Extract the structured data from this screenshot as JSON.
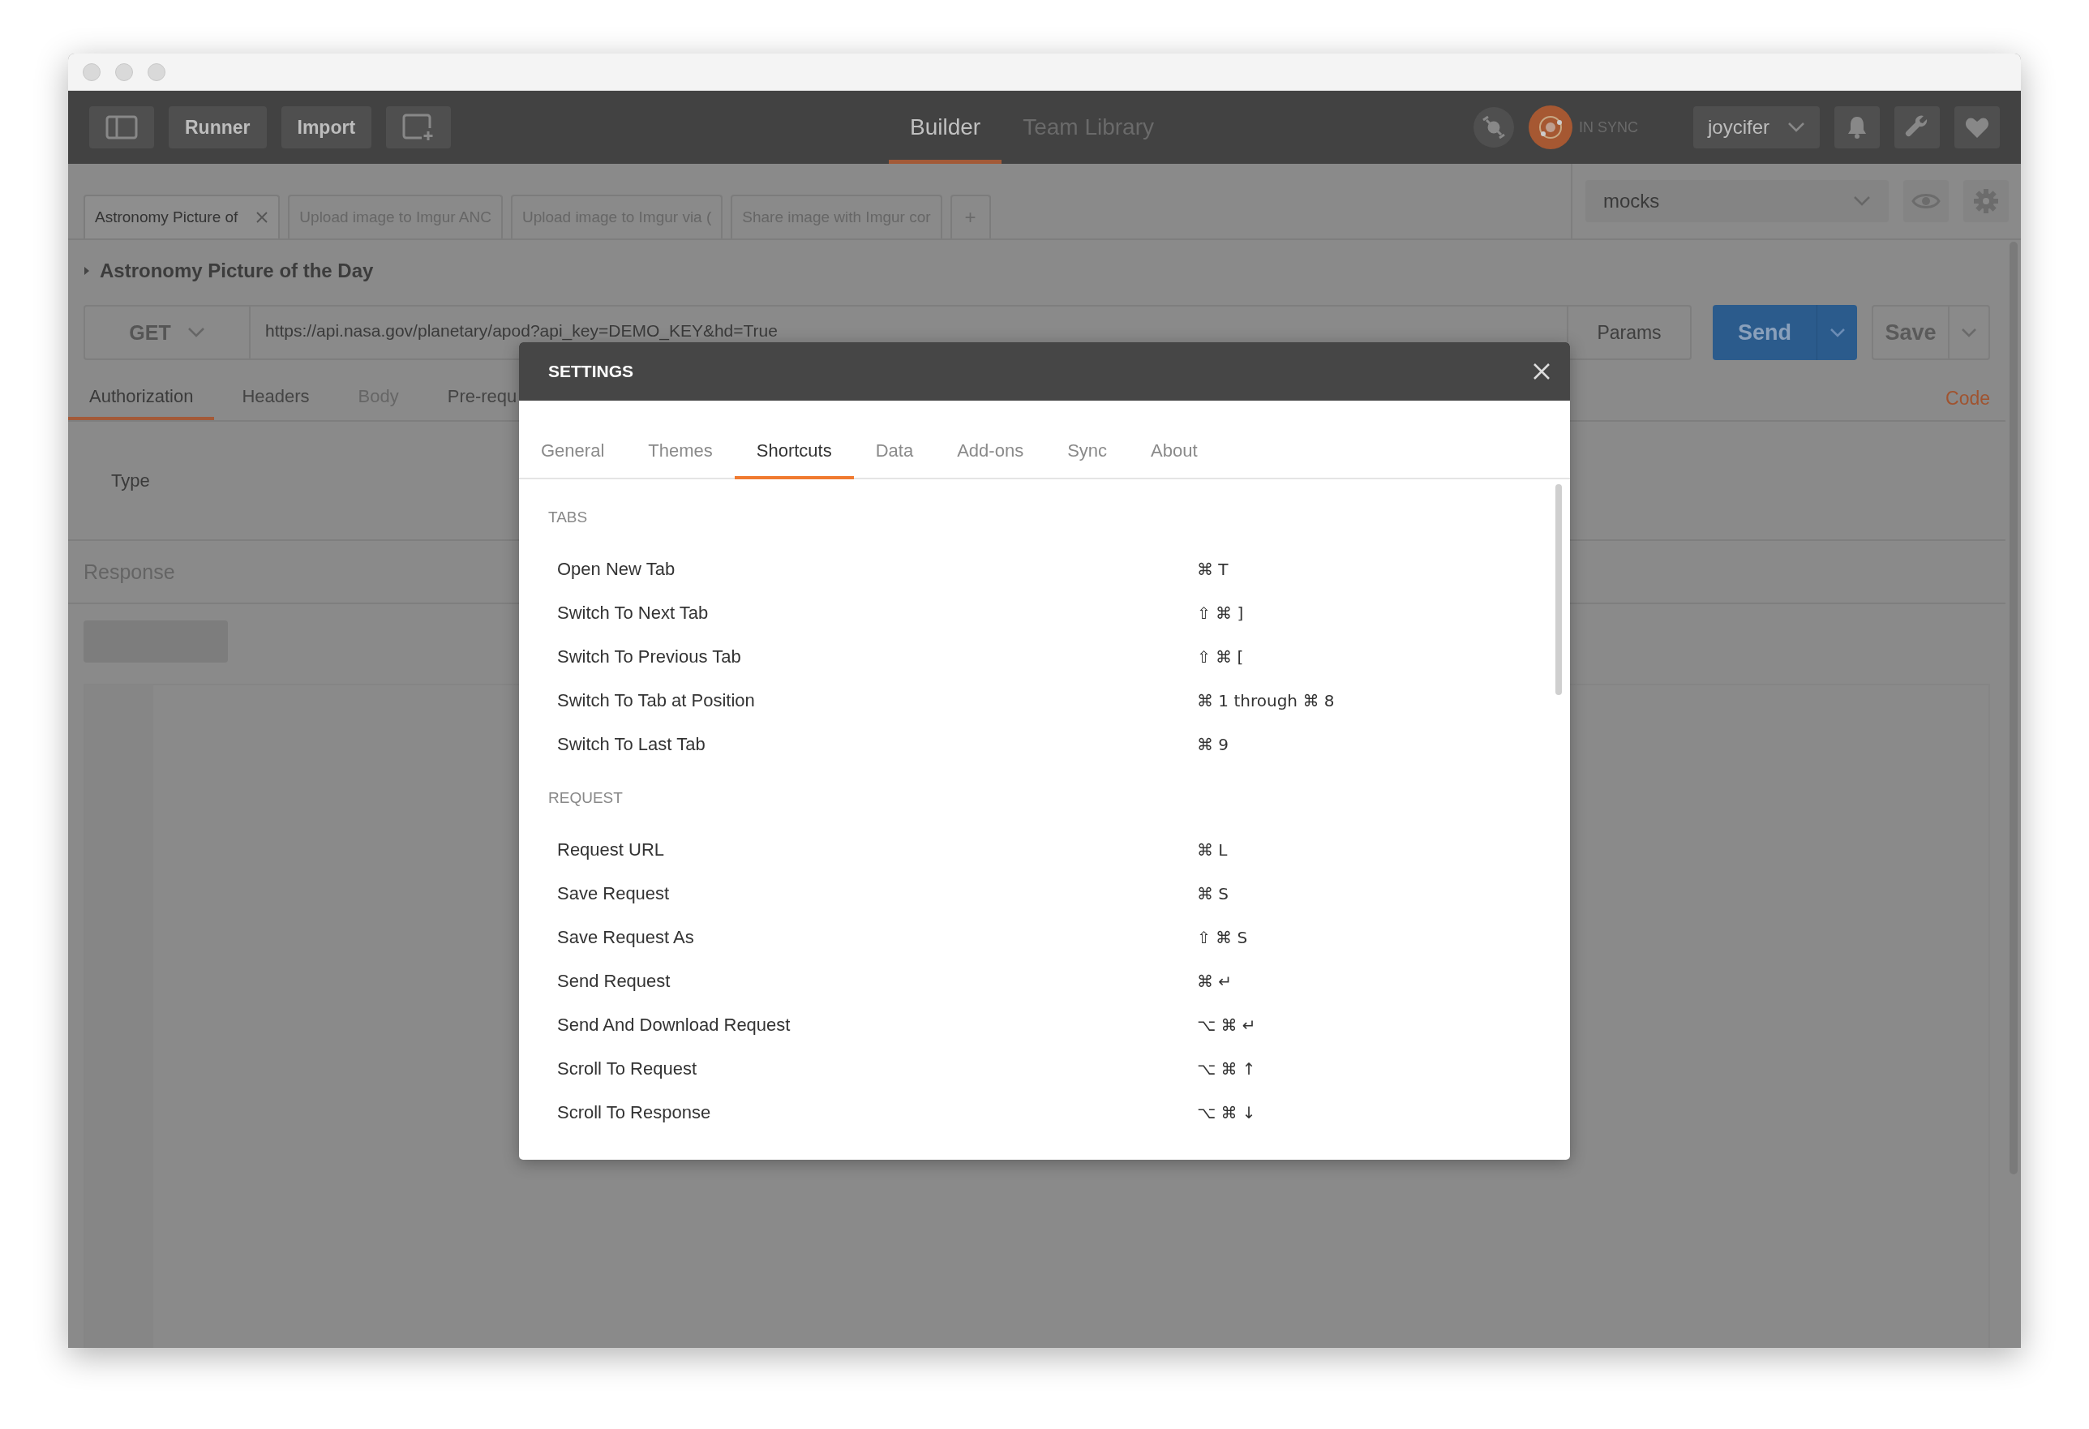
{
  "toolbar": {
    "buttons": [
      {
        "kind": "icon"
      },
      {
        "kind": "text",
        "label": "Runner"
      },
      {
        "kind": "text",
        "label": "Import"
      },
      {
        "kind": "newwin"
      }
    ],
    "nav_tabs": [
      {
        "label": "Builder",
        "selected": true
      },
      {
        "label": "Team Library",
        "selected": false
      }
    ],
    "sync_status": "IN SYNC",
    "user": "joycifer"
  },
  "request_tabs": [
    {
      "label": "Astronomy Picture of",
      "selected": true
    },
    {
      "label": "Upload image to Imgur ANC",
      "selected": false
    },
    {
      "label": "Upload image to Imgur via (",
      "selected": false
    },
    {
      "label": "Share image with Imgur cor",
      "selected": false
    }
  ],
  "new_tab_label": "+",
  "environment": "mocks",
  "request": {
    "name": "Astronomy Picture of the Day",
    "method": "GET",
    "url": "https://api.nasa.gov/planetary/apod?api_key=DEMO_KEY&hd=True",
    "params": "Params",
    "send": "Send",
    "save": "Save"
  },
  "subtabs": [
    {
      "label": "Authorization",
      "selected": true,
      "disabled": false
    },
    {
      "label": "Headers",
      "selected": false,
      "disabled": false
    },
    {
      "label": "Body",
      "selected": false,
      "disabled": true
    },
    {
      "label": "Pre-requ",
      "selected": false,
      "disabled": false
    }
  ],
  "code_link": "Code",
  "auth_type_label": "Type",
  "response_label": "Response",
  "settings": {
    "title": "SETTINGS",
    "tabs": [
      {
        "label": "General",
        "selected": false
      },
      {
        "label": "Themes",
        "selected": false
      },
      {
        "label": "Shortcuts",
        "selected": true
      },
      {
        "label": "Data",
        "selected": false
      },
      {
        "label": "Add-ons",
        "selected": false
      },
      {
        "label": "Sync",
        "selected": false
      },
      {
        "label": "About",
        "selected": false
      }
    ],
    "sections": [
      {
        "heading": "TABS",
        "shortcuts": [
          {
            "action": "Open New Tab",
            "keys": "⌘ T"
          },
          {
            "action": "Switch To Next Tab",
            "keys": "⇧ ⌘ ]"
          },
          {
            "action": "Switch To Previous Tab",
            "keys": "⇧ ⌘ ["
          },
          {
            "action": "Switch To Tab at Position",
            "keys": "⌘ 1 through ⌘ 8"
          },
          {
            "action": "Switch To Last Tab",
            "keys": "⌘ 9"
          }
        ]
      },
      {
        "heading": "REQUEST",
        "shortcuts": [
          {
            "action": "Request URL",
            "keys": "⌘ L"
          },
          {
            "action": "Save Request",
            "keys": "⌘ S"
          },
          {
            "action": "Save Request As",
            "keys": "⇧ ⌘ S"
          },
          {
            "action": "Send Request",
            "keys": "⌘ ↵"
          },
          {
            "action": "Send And Download Request",
            "keys": "⌥ ⌘ ↵"
          },
          {
            "action": "Scroll To Request",
            "keys": "⌥ ⌘ ↑"
          },
          {
            "action": "Scroll To Response",
            "keys": "⌥ ⌘ ↓"
          }
        ]
      }
    ]
  }
}
